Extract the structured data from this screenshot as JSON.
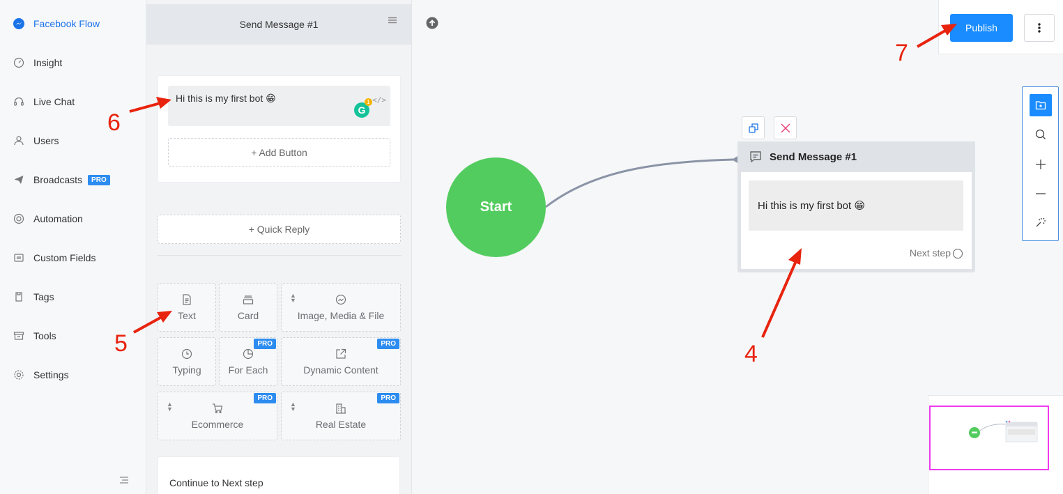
{
  "nav": {
    "items": [
      {
        "label": "Facebook Flow",
        "icon": "messenger-icon",
        "active": true
      },
      {
        "label": "Insight",
        "icon": "gauge-icon"
      },
      {
        "label": "Live Chat",
        "icon": "headset-icon"
      },
      {
        "label": "Users",
        "icon": "user-icon"
      },
      {
        "label": "Broadcasts",
        "icon": "paper-plane-icon",
        "badge": "PRO"
      },
      {
        "label": "Automation",
        "icon": "lifebuoy-icon"
      },
      {
        "label": "Custom Fields",
        "icon": "fields-icon"
      },
      {
        "label": "Tags",
        "icon": "tag-icon"
      },
      {
        "label": "Tools",
        "icon": "archive-icon"
      },
      {
        "label": "Settings",
        "icon": "gear-icon"
      }
    ]
  },
  "panel": {
    "title": "Send Message #1",
    "message_text": "Hi this is my first bot 😁",
    "grammarly_count": "1",
    "add_button_label": "+ Add Button",
    "quick_reply_label": "+ Quick Reply",
    "tiles": {
      "text": "Text",
      "card": "Card",
      "image_media_file": "Image, Media & File",
      "typing": "Typing",
      "for_each": "For Each",
      "dynamic_content": "Dynamic Content",
      "ecommerce": "Ecommerce",
      "real_estate": "Real Estate",
      "pro_badge": "PRO"
    },
    "continue_label": "Continue to Next step"
  },
  "canvas": {
    "publish_label": "Publish",
    "start_label": "Start",
    "node_title": "Send Message #1",
    "node_message": "Hi this is my first bot 😁",
    "next_step_label": "Next step",
    "accent_color": "#1a8cff",
    "start_color": "#53cc5f",
    "minimap_frame_color": "#ee3bf0"
  },
  "annotations": {
    "a4": "4",
    "a5": "5",
    "a6": "6",
    "a7": "7"
  }
}
